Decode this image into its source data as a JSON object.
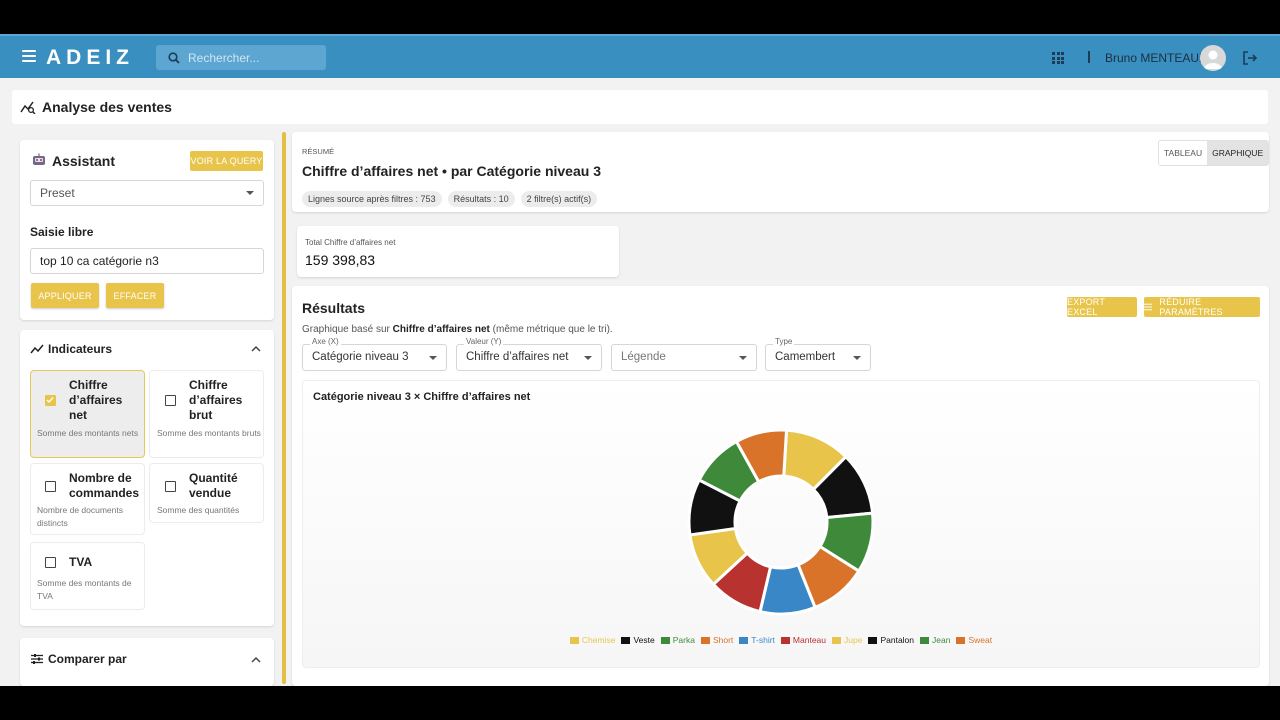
{
  "app": {
    "logo": "ADEIZ",
    "search_placeholder": "Rechercher...",
    "user_name": "Bruno MENTEAUX",
    "icons": [
      "menu-icon",
      "search-icon",
      "apps-grid-icon",
      "avatar-icon",
      "logout-icon"
    ]
  },
  "page": {
    "title": "Analyse des ventes"
  },
  "assistant": {
    "title": "Assistant",
    "query_button": "VOIR LA QUERY",
    "preset_value": "Preset",
    "free_input_label": "Saisie libre",
    "free_input_value": "top 10 ca catégorie n3",
    "apply_button": "APPLIQUER",
    "clear_button": "EFFACER"
  },
  "indicators": {
    "title": "Indicateurs",
    "items": [
      {
        "name": "Chiffre d’affaires net",
        "desc": "Somme des montants nets",
        "checked": true
      },
      {
        "name": "Chiffre d’affaires brut",
        "desc": "Somme des montants bruts",
        "checked": false
      },
      {
        "name": "Nombre de commandes",
        "desc": "Nombre de documents distincts",
        "checked": false
      },
      {
        "name": "Quantité vendue",
        "desc": "Somme des quantités",
        "checked": false
      },
      {
        "name": "TVA",
        "desc": "Somme des montants de TVA",
        "checked": false
      }
    ]
  },
  "compare": {
    "title": "Comparer par"
  },
  "summary": {
    "eyebrow": "RÉSUMÉ",
    "title": "Chiffre d’affaires net • par Catégorie niveau 3",
    "chips": [
      "Lignes source après filtres : 753",
      "Résultats : 10",
      "2 filtre(s) actif(s)"
    ],
    "view_table": "TABLEAU",
    "view_chart": "GRAPHIQUE",
    "active_view": "GRAPHIQUE"
  },
  "kpi": {
    "label": "Total Chiffre d’affaires net",
    "value": "159 398,83"
  },
  "results": {
    "title": "Résultats",
    "export_button": "EXPORT EXCEL",
    "reduce_button": "RÉDUIRE PARAMÈTRES",
    "desc_prefix": "Graphique basé sur ",
    "desc_metric": "Chiffre d’affaires net",
    "desc_suffix": " (même métrique que le tri).",
    "axis_x_label": "Axe (X)",
    "axis_x_value": "Catégorie niveau 3",
    "value_y_label": "Valeur (Y)",
    "value_y_value": "Chiffre d’affaires net",
    "legend_placeholder": "Légende",
    "type_label": "Type",
    "type_value": "Camembert",
    "chart_title": "Catégorie niveau 3 × Chiffre d’affaires net"
  },
  "colors": {
    "topbar": "#3a8fc1",
    "accent": "#e8c54a"
  },
  "chart_data": {
    "type": "pie",
    "donut": true,
    "title": "Catégorie niveau 3 × Chiffre d’affaires net",
    "legend_position": "bottom",
    "series": [
      {
        "name": "Chemise",
        "color": "#e8c54a",
        "value": 11.5
      },
      {
        "name": "Veste",
        "color": "#111111",
        "value": 11
      },
      {
        "name": "Parka",
        "color": "#3f8a3a",
        "value": 10.5
      },
      {
        "name": "Short",
        "color": "#d9732a",
        "value": 10
      },
      {
        "name": "T-shirt",
        "color": "#3a87c8",
        "value": 9.7
      },
      {
        "name": "Manteau",
        "color": "#b8322f",
        "value": 9.5
      },
      {
        "name": "Jupe",
        "color": "#e8c54a",
        "value": 9.6
      },
      {
        "name": "Pantalon",
        "color": "#111111",
        "value": 9.8
      },
      {
        "name": "Jean",
        "color": "#3f8a3a",
        "value": 9.4
      },
      {
        "name": "Sweat",
        "color": "#d9732a",
        "value": 9
      }
    ]
  }
}
